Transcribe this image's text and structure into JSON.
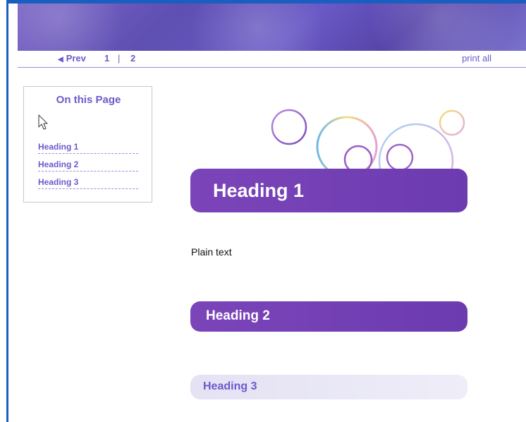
{
  "nav": {
    "prev_label": "Prev",
    "prev_arrow": "◀",
    "pages": [
      "1",
      "2"
    ],
    "separator": "|",
    "print_all": "print all"
  },
  "sidebar": {
    "title": "On this Page",
    "links": [
      "Heading 1",
      "Heading 2",
      "Heading 3"
    ]
  },
  "content": {
    "heading1": "Heading 1",
    "plain_text": "Plain text",
    "heading2": "Heading 2",
    "heading3": "Heading 3"
  },
  "colors": {
    "frame": "#1a5fc0",
    "accent": "#6a5acd",
    "heading_banner": "#7b45b9",
    "heading3_banner": "#e4e2f3"
  },
  "icons": {
    "pointer": "pointer-cursor-icon",
    "prev": "left-triangle-icon"
  }
}
